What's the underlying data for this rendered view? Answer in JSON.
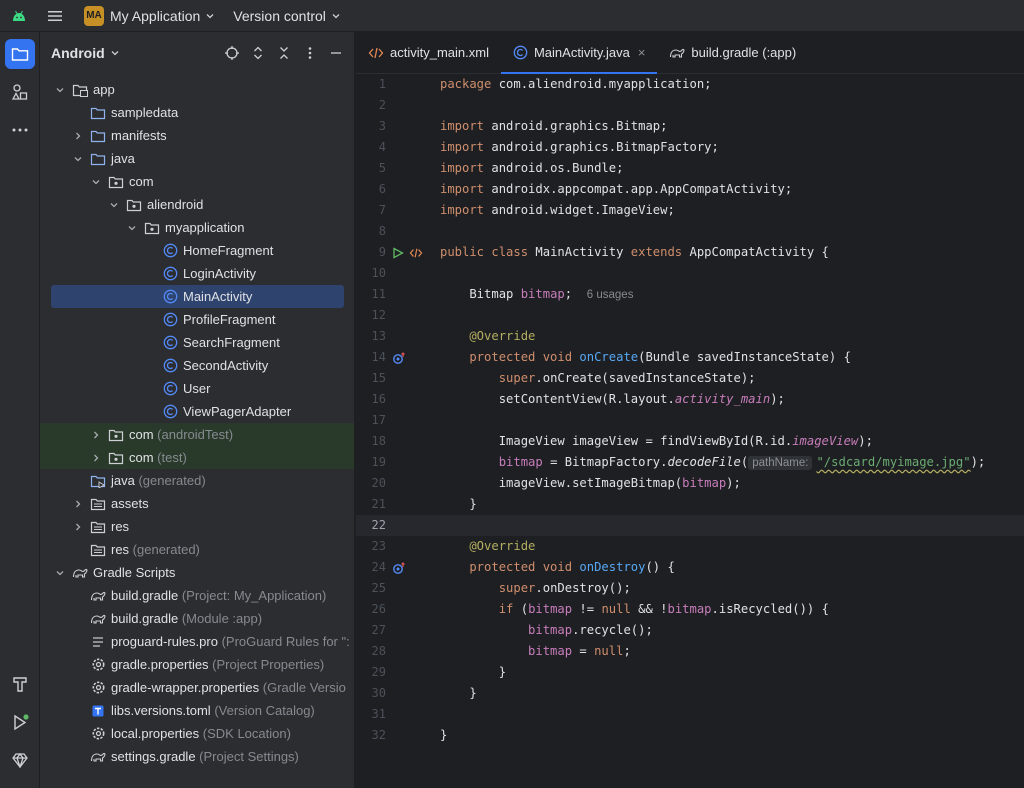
{
  "titlebar": {
    "project_badge": "MA",
    "project_name": "My Application",
    "vcs_label": "Version control"
  },
  "project_panel": {
    "title": "Android"
  },
  "tree": [
    {
      "label": "app",
      "sub": "",
      "depth": 0,
      "arrow": "down",
      "icon": "module-folder-icon"
    },
    {
      "label": "sampledata",
      "sub": "",
      "depth": 1,
      "arrow": "",
      "icon": "folder-icon"
    },
    {
      "label": "manifests",
      "sub": "",
      "depth": 1,
      "arrow": "right",
      "icon": "folder-icon"
    },
    {
      "label": "java",
      "sub": "",
      "depth": 1,
      "arrow": "down",
      "icon": "folder-icon"
    },
    {
      "label": "com",
      "sub": "",
      "depth": 2,
      "arrow": "down",
      "icon": "package-icon"
    },
    {
      "label": "aliendroid",
      "sub": "",
      "depth": 3,
      "arrow": "down",
      "icon": "package-icon"
    },
    {
      "label": "myapplication",
      "sub": "",
      "depth": 4,
      "arrow": "down",
      "icon": "package-icon"
    },
    {
      "label": "HomeFragment",
      "sub": "",
      "depth": 5,
      "arrow": "",
      "icon": "class-icon"
    },
    {
      "label": "LoginActivity",
      "sub": "",
      "depth": 5,
      "arrow": "",
      "icon": "class-icon"
    },
    {
      "label": "MainActivity",
      "sub": "",
      "depth": 5,
      "arrow": "",
      "icon": "class-icon",
      "selected": true
    },
    {
      "label": "ProfileFragment",
      "sub": "",
      "depth": 5,
      "arrow": "",
      "icon": "class-icon"
    },
    {
      "label": "SearchFragment",
      "sub": "",
      "depth": 5,
      "arrow": "",
      "icon": "class-icon"
    },
    {
      "label": "SecondActivity",
      "sub": "",
      "depth": 5,
      "arrow": "",
      "icon": "class-icon"
    },
    {
      "label": "User",
      "sub": "",
      "depth": 5,
      "arrow": "",
      "icon": "class-icon"
    },
    {
      "label": "ViewPagerAdapter",
      "sub": "",
      "depth": 5,
      "arrow": "",
      "icon": "class-icon"
    },
    {
      "label": "com",
      "sub": "(androidTest)",
      "depth": 2,
      "arrow": "right",
      "icon": "package-icon",
      "test": true
    },
    {
      "label": "com",
      "sub": "(test)",
      "depth": 2,
      "arrow": "right",
      "icon": "package-icon",
      "test": true
    },
    {
      "label": "java",
      "sub": "(generated)",
      "depth": 1,
      "arrow": "",
      "icon": "generated-folder-icon"
    },
    {
      "label": "assets",
      "sub": "",
      "depth": 1,
      "arrow": "right",
      "icon": "resource-folder-icon"
    },
    {
      "label": "res",
      "sub": "",
      "depth": 1,
      "arrow": "right",
      "icon": "resource-folder-icon"
    },
    {
      "label": "res",
      "sub": "(generated)",
      "depth": 1,
      "arrow": "",
      "icon": "resource-folder-icon"
    },
    {
      "label": "Gradle Scripts",
      "sub": "",
      "depth": 0,
      "arrow": "down",
      "icon": "gradle-icon"
    },
    {
      "label": "build.gradle",
      "sub": "(Project: My_Application)",
      "depth": 1,
      "arrow": "",
      "icon": "gradle-icon"
    },
    {
      "label": "build.gradle",
      "sub": "(Module :app)",
      "depth": 1,
      "arrow": "",
      "icon": "gradle-icon"
    },
    {
      "label": "proguard-rules.pro",
      "sub": "(ProGuard Rules for \":",
      "depth": 1,
      "arrow": "",
      "icon": "text-file-icon"
    },
    {
      "label": "gradle.properties",
      "sub": "(Project Properties)",
      "depth": 1,
      "arrow": "",
      "icon": "settings-file-icon"
    },
    {
      "label": "gradle-wrapper.properties",
      "sub": "(Gradle Versio",
      "depth": 1,
      "arrow": "",
      "icon": "settings-file-icon"
    },
    {
      "label": "libs.versions.toml",
      "sub": "(Version Catalog)",
      "depth": 1,
      "arrow": "",
      "icon": "toml-file-icon"
    },
    {
      "label": "local.properties",
      "sub": "(SDK Location)",
      "depth": 1,
      "arrow": "",
      "icon": "settings-file-icon"
    },
    {
      "label": "settings.gradle",
      "sub": "(Project Settings)",
      "depth": 1,
      "arrow": "",
      "icon": "gradle-icon"
    }
  ],
  "tabs": [
    {
      "label": "activity_main.xml",
      "icon": "xml-icon",
      "active": false,
      "closable": false
    },
    {
      "label": "MainActivity.java",
      "icon": "class-icon",
      "active": true,
      "closable": true
    },
    {
      "label": "build.gradle (:app)",
      "icon": "gradle-icon",
      "active": false,
      "closable": false
    }
  ],
  "code": {
    "current_line": 22,
    "usage_hint": "6 usages",
    "param_hint": "pathName:",
    "lines": [
      [
        [
          "kw",
          "package "
        ],
        [
          "",
          "com.aliendroid.myapplication;"
        ]
      ],
      [],
      [
        [
          "kw",
          "import "
        ],
        [
          "",
          "android.graphics.Bitmap;"
        ]
      ],
      [
        [
          "kw",
          "import "
        ],
        [
          "",
          "android.graphics.BitmapFactory;"
        ]
      ],
      [
        [
          "kw",
          "import "
        ],
        [
          "",
          "android.os.Bundle;"
        ]
      ],
      [
        [
          "kw",
          "import "
        ],
        [
          "",
          "androidx.appcompat.app.AppCompatActivity;"
        ]
      ],
      [
        [
          "kw",
          "import "
        ],
        [
          "",
          "android.widget.ImageView;"
        ]
      ],
      [],
      [
        [
          "kw",
          "public class "
        ],
        [
          "",
          "MainActivity "
        ],
        [
          "kw",
          "extends "
        ],
        [
          "",
          "AppCompatActivity {"
        ]
      ],
      [],
      [
        [
          "",
          "    Bitmap "
        ],
        [
          "fld",
          "bitmap"
        ],
        [
          "",
          ";  "
        ],
        [
          "hint",
          "@usage"
        ]
      ],
      [],
      [
        [
          "an",
          "    @Override"
        ]
      ],
      [
        [
          "kw",
          "    protected void "
        ],
        [
          "fn",
          "onCreate"
        ],
        [
          "",
          "(Bundle savedInstanceState) {"
        ]
      ],
      [
        [
          "kw",
          "        super"
        ],
        [
          "",
          "."
        ],
        [
          "",
          "onCreate(savedInstanceState);"
        ]
      ],
      [
        [
          "",
          "        setContentView(R.layout."
        ],
        [
          "fld it",
          "activity_main"
        ],
        [
          "",
          ");"
        ]
      ],
      [],
      [
        [
          "",
          "        ImageView imageView = findViewById(R.id."
        ],
        [
          "fld it",
          "imageView"
        ],
        [
          "",
          ");"
        ]
      ],
      [
        [
          "fld",
          "        bitmap"
        ],
        [
          "",
          " = BitmapFactory."
        ],
        [
          "it",
          "decodeFile"
        ],
        [
          "",
          "("
        ],
        [
          "ph",
          "@param"
        ],
        [
          "st wavy",
          "\"/sdcard/myimage.jpg\""
        ],
        [
          "",
          ");"
        ]
      ],
      [
        [
          "",
          "        imageView.setImageBitmap("
        ],
        [
          "fld",
          "bitmap"
        ],
        [
          "",
          ");"
        ]
      ],
      [
        [
          "",
          "    }"
        ]
      ],
      [],
      [
        [
          "an",
          "    @Override"
        ]
      ],
      [
        [
          "kw",
          "    protected void "
        ],
        [
          "fn",
          "onDestroy"
        ],
        [
          "",
          "() {"
        ]
      ],
      [
        [
          "kw",
          "        super"
        ],
        [
          "",
          ".onDestroy();"
        ]
      ],
      [
        [
          "kw",
          "        if "
        ],
        [
          "",
          "("
        ],
        [
          "fld",
          "bitmap"
        ],
        [
          "",
          " != "
        ],
        [
          "kw",
          "null "
        ],
        [
          "",
          "&& !"
        ],
        [
          "fld",
          "bitmap"
        ],
        [
          "",
          ".isRecycled()) {"
        ]
      ],
      [
        [
          "fld",
          "            bitmap"
        ],
        [
          "",
          ".recycle();"
        ]
      ],
      [
        [
          "fld",
          "            bitmap"
        ],
        [
          "",
          " = "
        ],
        [
          "kw",
          "null"
        ],
        [
          "",
          ";"
        ]
      ],
      [
        [
          "",
          "        }"
        ]
      ],
      [
        [
          "",
          "    }"
        ]
      ],
      [],
      [
        [
          "",
          "}"
        ]
      ]
    ],
    "gutter_run": [
      9
    ],
    "gutter_override": [
      14,
      24
    ]
  },
  "colors": {
    "accent": "#3574f0",
    "keyword": "#cf8e6d",
    "annotation": "#b3ae60",
    "method": "#56a8f5",
    "field": "#c77dbb",
    "string": "#6aab73"
  }
}
